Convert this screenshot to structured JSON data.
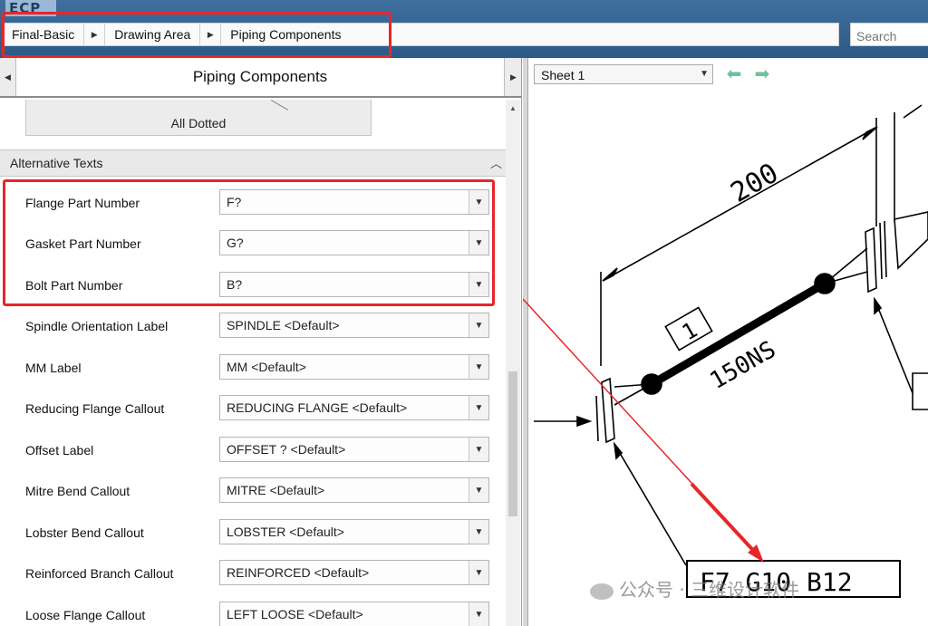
{
  "app": {
    "logo_text": "ECP"
  },
  "breadcrumb": [
    {
      "label": "Final-Basic"
    },
    {
      "label": "Drawing Area"
    },
    {
      "label": "Piping Components"
    }
  ],
  "search": {
    "placeholder": "Search"
  },
  "left_panel": {
    "title": "Piping Components",
    "tile_label": "All Dotted",
    "section_title": "Alternative Texts",
    "rows": [
      {
        "label": "Flange Part Number",
        "value": "F?"
      },
      {
        "label": "Gasket Part Number",
        "value": "G?"
      },
      {
        "label": "Bolt Part Number",
        "value": "B?"
      },
      {
        "label": "Spindle Orientation Label",
        "value": "SPINDLE <Default>"
      },
      {
        "label": "MM Label",
        "value": "MM <Default>"
      },
      {
        "label": "Reducing Flange Callout",
        "value": "REDUCING FLANGE <Default>"
      },
      {
        "label": "Offset Label",
        "value": "OFFSET ? <Default>"
      },
      {
        "label": "Mitre Bend Callout",
        "value": "MITRE <Default>"
      },
      {
        "label": "Lobster Bend Callout",
        "value": "LOBSTER <Default>"
      },
      {
        "label": "Reinforced Branch Callout",
        "value": "REINFORCED <Default>"
      },
      {
        "label": "Loose Flange Callout",
        "value": "LEFT LOOSE <Default>"
      }
    ]
  },
  "right_panel": {
    "sheet_value": "Sheet 1",
    "drawing": {
      "dimension": "200",
      "pipe_spec": "150NS",
      "item_number": "1",
      "callout": "F7 G10 B12"
    }
  },
  "watermark": "公众号 · 三维设计软件",
  "colors": {
    "highlight": "#e8262a",
    "topbar": "#3f6f9e",
    "nav_arrow": "#6ec29b"
  }
}
